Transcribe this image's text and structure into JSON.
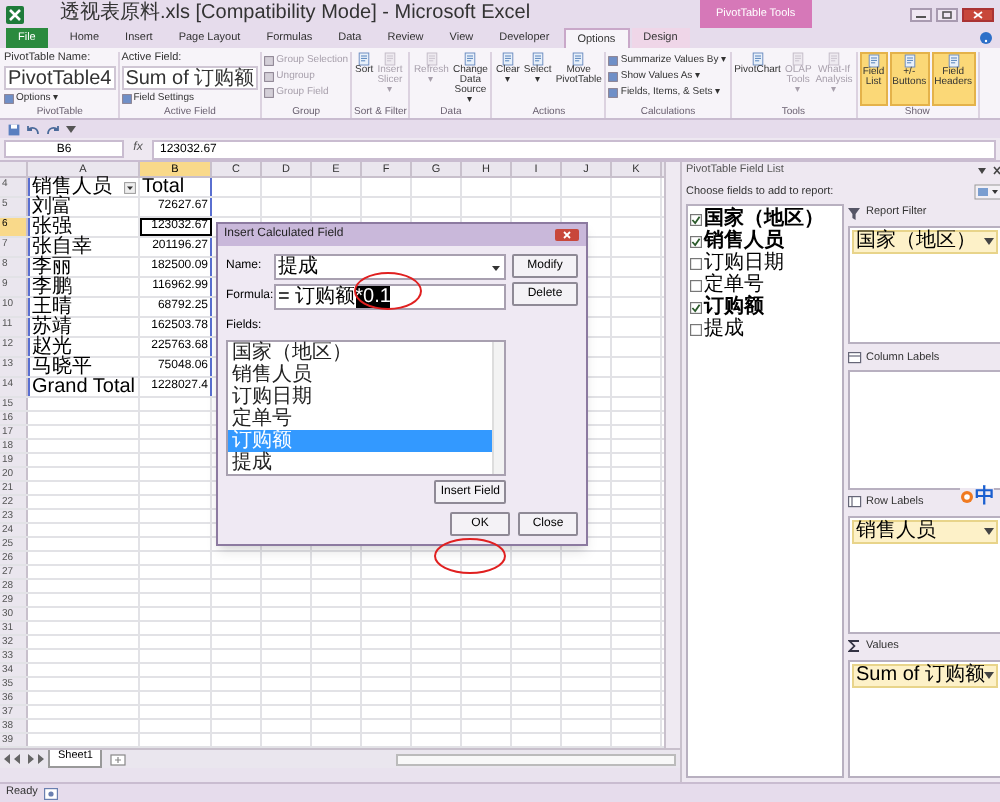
{
  "window": {
    "title": "透视表原料.xls [Compatibility Mode] - Microsoft Excel",
    "context_label": "PivotTable Tools"
  },
  "tabs": [
    {
      "label": "File",
      "kind": "file",
      "selected": false
    },
    {
      "label": "Home",
      "kind": "normal",
      "selected": false
    },
    {
      "label": "Insert",
      "kind": "normal",
      "selected": false
    },
    {
      "label": "Page Layout",
      "kind": "normal",
      "selected": false
    },
    {
      "label": "Formulas",
      "kind": "normal",
      "selected": false
    },
    {
      "label": "Data",
      "kind": "normal",
      "selected": false
    },
    {
      "label": "Review",
      "kind": "normal",
      "selected": false
    },
    {
      "label": "View",
      "kind": "normal",
      "selected": false
    },
    {
      "label": "Developer",
      "kind": "normal",
      "selected": false
    },
    {
      "label": "Options",
      "kind": "context",
      "selected": true
    },
    {
      "label": "Design",
      "kind": "context",
      "selected": false
    }
  ],
  "ribbon": [
    {
      "label": "PivotTable",
      "items": [
        {
          "kind": "label",
          "text": "PivotTable Name:",
          "disabled": false
        },
        {
          "kind": "field",
          "text": "PivotTable4",
          "disabled": false
        },
        {
          "kind": "small",
          "text": "Options ▾",
          "disabled": false
        }
      ]
    },
    {
      "label": "Active Field",
      "items": [
        {
          "kind": "label",
          "text": "Active Field:",
          "disabled": false
        },
        {
          "kind": "field",
          "text": "Sum of 订购额",
          "disabled": false
        },
        {
          "kind": "small",
          "text": "Field Settings",
          "disabled": false
        }
      ]
    },
    {
      "label": "Group",
      "items": [
        {
          "kind": "small",
          "text": "Group Selection",
          "disabled": true
        },
        {
          "kind": "small",
          "text": "Ungroup",
          "disabled": true
        },
        {
          "kind": "small",
          "text": "Group Field",
          "disabled": true
        }
      ]
    },
    {
      "label": "Sort & Filter",
      "items": [
        {
          "kind": "large",
          "text": "Sort",
          "disabled": false
        },
        {
          "kind": "large",
          "text": "Insert Slicer ▾",
          "disabled": true
        }
      ]
    },
    {
      "label": "Data",
      "items": [
        {
          "kind": "large",
          "text": "Refresh ▾",
          "disabled": true
        },
        {
          "kind": "large",
          "text": "Change Data Source ▾",
          "disabled": false
        }
      ]
    },
    {
      "label": "Actions",
      "items": [
        {
          "kind": "large",
          "text": "Clear ▾",
          "disabled": false
        },
        {
          "kind": "large",
          "text": "Select ▾",
          "disabled": false
        },
        {
          "kind": "large",
          "text": "Move PivotTable",
          "disabled": false
        }
      ]
    },
    {
      "label": "Calculations",
      "items": [
        {
          "kind": "small",
          "text": "Summarize Values By ▾",
          "disabled": false
        },
        {
          "kind": "small",
          "text": "Show Values As ▾",
          "disabled": false
        },
        {
          "kind": "small",
          "text": "Fields, Items, & Sets ▾",
          "disabled": false
        }
      ]
    },
    {
      "label": "Tools",
      "items": [
        {
          "kind": "large",
          "text": "PivotChart",
          "disabled": false
        },
        {
          "kind": "large",
          "text": "OLAP Tools ▾",
          "disabled": true
        },
        {
          "kind": "large",
          "text": "What-If Analysis ▾",
          "disabled": true
        }
      ]
    },
    {
      "label": "Show",
      "items": [
        {
          "kind": "large",
          "text": "Field List",
          "disabled": false,
          "on": true
        },
        {
          "kind": "large",
          "text": "+/- Buttons",
          "disabled": false,
          "on": true
        },
        {
          "kind": "large",
          "text": "Field Headers",
          "disabled": false,
          "on": true
        }
      ]
    }
  ],
  "formula_bar": {
    "name_box": "B6",
    "fx": "fx",
    "value": "123032.67"
  },
  "sheet": {
    "columns": [
      {
        "label": "A",
        "selected": false
      },
      {
        "label": "B",
        "selected": true
      },
      {
        "label": "C",
        "selected": false
      },
      {
        "label": "D",
        "selected": false
      },
      {
        "label": "E",
        "selected": false
      },
      {
        "label": "F",
        "selected": false
      },
      {
        "label": "G",
        "selected": false
      },
      {
        "label": "H",
        "selected": false
      },
      {
        "label": "I",
        "selected": false
      },
      {
        "label": "J",
        "selected": false
      },
      {
        "label": "K",
        "selected": false
      }
    ],
    "rows": [
      {
        "number": "4",
        "selected": false,
        "cells": [
          {
            "text": "销售人员",
            "kind": "text",
            "filter": true
          },
          {
            "text": "Total",
            "kind": "text",
            "filter": false
          }
        ]
      },
      {
        "number": "5",
        "selected": false,
        "cells": [
          {
            "text": "刘富",
            "kind": "text",
            "filter": false
          },
          {
            "text": "72627.67",
            "kind": "number",
            "filter": false
          }
        ]
      },
      {
        "number": "6",
        "selected": true,
        "cells": [
          {
            "text": "张强",
            "kind": "text",
            "filter": false
          },
          {
            "text": "123032.67",
            "kind": "number",
            "filter": false
          }
        ]
      },
      {
        "number": "7",
        "selected": false,
        "cells": [
          {
            "text": "张自幸",
            "kind": "text",
            "filter": false
          },
          {
            "text": "201196.27",
            "kind": "number",
            "filter": false
          }
        ]
      },
      {
        "number": "8",
        "selected": false,
        "cells": [
          {
            "text": "李丽",
            "kind": "text",
            "filter": false
          },
          {
            "text": "182500.09",
            "kind": "number",
            "filter": false
          }
        ]
      },
      {
        "number": "9",
        "selected": false,
        "cells": [
          {
            "text": "李鹏",
            "kind": "text",
            "filter": false
          },
          {
            "text": "116962.99",
            "kind": "number",
            "filter": false
          }
        ]
      },
      {
        "number": "10",
        "selected": false,
        "cells": [
          {
            "text": "王晴",
            "kind": "text",
            "filter": false
          },
          {
            "text": "68792.25",
            "kind": "number",
            "filter": false
          }
        ]
      },
      {
        "number": "11",
        "selected": false,
        "cells": [
          {
            "text": "苏靖",
            "kind": "text",
            "filter": false
          },
          {
            "text": "162503.78",
            "kind": "number",
            "filter": false
          }
        ]
      },
      {
        "number": "12",
        "selected": false,
        "cells": [
          {
            "text": "赵光",
            "kind": "text",
            "filter": false
          },
          {
            "text": "225763.68",
            "kind": "number",
            "filter": false
          }
        ]
      },
      {
        "number": "13",
        "selected": false,
        "cells": [
          {
            "text": "马晓平",
            "kind": "text",
            "filter": false
          },
          {
            "text": "75048.06",
            "kind": "number",
            "filter": false
          }
        ]
      },
      {
        "number": "14",
        "selected": false,
        "cells": [
          {
            "text": "Grand Total",
            "kind": "text",
            "filter": false
          },
          {
            "text": "1228027.4",
            "kind": "number",
            "filter": false
          }
        ]
      },
      {
        "number": "15",
        "selected": false
      },
      {
        "number": "16",
        "selected": false
      },
      {
        "number": "17",
        "selected": false
      },
      {
        "number": "18",
        "selected": false
      },
      {
        "number": "19",
        "selected": false
      },
      {
        "number": "20",
        "selected": false
      },
      {
        "number": "21",
        "selected": false
      },
      {
        "number": "22",
        "selected": false
      },
      {
        "number": "23",
        "selected": false
      },
      {
        "number": "24",
        "selected": false
      },
      {
        "number": "25",
        "selected": false
      },
      {
        "number": "26",
        "selected": false
      },
      {
        "number": "27",
        "selected": false
      },
      {
        "number": "28",
        "selected": false
      },
      {
        "number": "29",
        "selected": false
      },
      {
        "number": "30",
        "selected": false
      },
      {
        "number": "31",
        "selected": false
      },
      {
        "number": "32",
        "selected": false
      },
      {
        "number": "33",
        "selected": false
      },
      {
        "number": "34",
        "selected": false
      },
      {
        "number": "35",
        "selected": false
      },
      {
        "number": "36",
        "selected": false
      },
      {
        "number": "37",
        "selected": false
      },
      {
        "number": "38",
        "selected": false
      },
      {
        "number": "39",
        "selected": false
      }
    ],
    "sheet_tabs": [
      {
        "label": "Sheet1",
        "selected": true
      }
    ]
  },
  "dialog": {
    "title": "Insert Calculated Field",
    "name_label": "Name:",
    "name_value": "提成",
    "formula_label": "Formula:",
    "formula_value": "= 订购额",
    "formula_selection": "*0.1",
    "fields_label": "Fields:",
    "fields": [
      {
        "label": "国家（地区）",
        "selected": false
      },
      {
        "label": "销售人员",
        "selected": false
      },
      {
        "label": "订购日期",
        "selected": false
      },
      {
        "label": "定单号",
        "selected": false
      },
      {
        "label": "订购额",
        "selected": true
      },
      {
        "label": "提成",
        "selected": false
      }
    ],
    "buttons": [
      {
        "label": "Modify",
        "kind": "modify"
      },
      {
        "label": "Delete",
        "kind": "delete"
      },
      {
        "label": "Insert Field",
        "kind": "insert"
      },
      {
        "label": "OK",
        "kind": "ok"
      },
      {
        "label": "Close",
        "kind": "close"
      }
    ]
  },
  "field_list": {
    "title": "PivotTable Field List",
    "prompt": "Choose fields to add to report:",
    "fields": [
      {
        "label": "国家（地区）",
        "checked": true
      },
      {
        "label": "销售人员",
        "checked": true
      },
      {
        "label": "订购日期",
        "checked": false
      },
      {
        "label": "定单号",
        "checked": false
      },
      {
        "label": "订购额",
        "checked": true
      },
      {
        "label": "提成",
        "checked": false
      }
    ],
    "areas": [
      {
        "label": "Report Filter",
        "kind": "filter",
        "items": [
          "国家（地区）"
        ]
      },
      {
        "label": "Column Labels",
        "kind": "columns"
      },
      {
        "label": "Row Labels",
        "kind": "rows",
        "items": [
          "销售人员"
        ]
      },
      {
        "label": "Values",
        "kind": "values",
        "items": [
          "Sum of 订购额"
        ]
      }
    ],
    "ime": "中"
  },
  "status_bar": {
    "text": "Ready"
  }
}
